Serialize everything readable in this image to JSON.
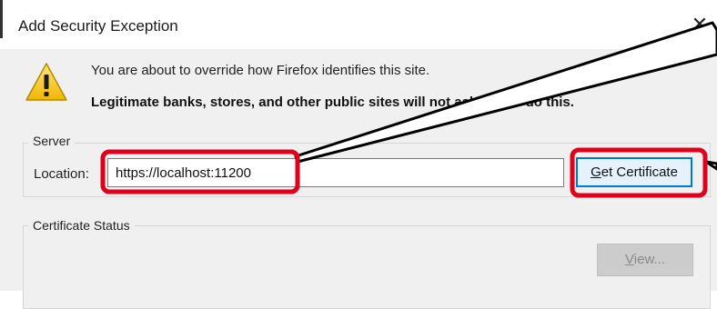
{
  "window": {
    "title": "Add Security Exception",
    "close_glyph": "✕"
  },
  "warning": {
    "icon": "warning-icon",
    "line1": "You are about to override how Firefox identifies this site.",
    "line2": "Legitimate banks, stores, and other public sites will not ask you to do this."
  },
  "server": {
    "legend": "Server",
    "location_label": "Location:",
    "location_value": "https://localhost:11200",
    "get_certificate_prefix": "G",
    "get_certificate_rest": "et Certificate"
  },
  "certificate_status": {
    "legend": "Certificate Status",
    "view_prefix": "V",
    "view_rest": "iew..."
  },
  "annotation": {
    "highlight_color": "#e0001b",
    "line_color": "#000000"
  }
}
